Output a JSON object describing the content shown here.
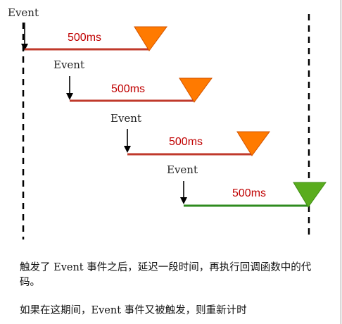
{
  "event_label": "Event",
  "delay_label": "500ms",
  "colors": {
    "pending_bar": "#c0392b",
    "pending_triangle": "#ff7a00",
    "fired_bar": "#2e8b1e",
    "fired_triangle": "#5aac1e",
    "delay_text": "#c00000",
    "guide_line": "#000000"
  },
  "timeline": [
    {
      "event": "Event",
      "delay": "500ms",
      "state": "cancelled"
    },
    {
      "event": "Event",
      "delay": "500ms",
      "state": "cancelled"
    },
    {
      "event": "Event",
      "delay": "500ms",
      "state": "cancelled"
    },
    {
      "event": "Event",
      "delay": "500ms",
      "state": "fired"
    }
  ],
  "description": {
    "line1": "触发了 Event 事件之后，延迟一段时间，再执行回调函数中的代码。",
    "line2": "如果在这期间，Event 事件又被触发，则重新计时"
  }
}
